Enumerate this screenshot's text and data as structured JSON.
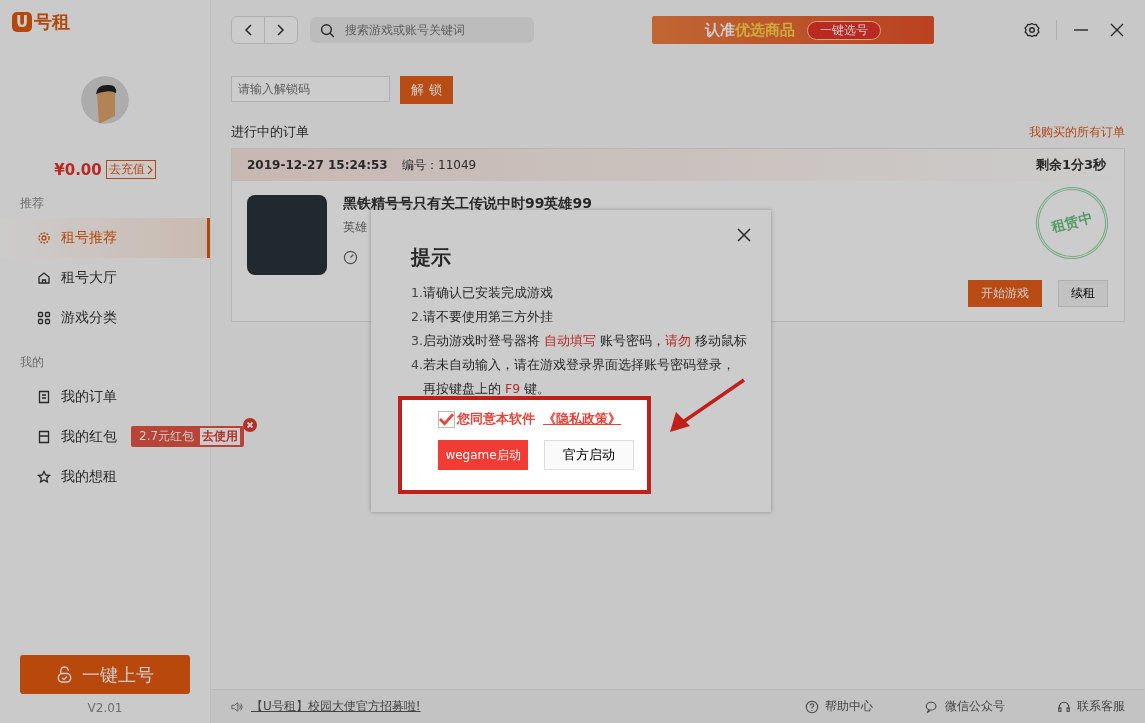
{
  "logo": {
    "mark": "U",
    "text": "号租"
  },
  "profile": {
    "balance": "¥0.00",
    "recharge": "去充值"
  },
  "sidebar": {
    "sections": [
      {
        "title": "推荐",
        "items": [
          {
            "label": "租号推荐",
            "selected": true
          },
          {
            "label": "租号大厅",
            "selected": false
          },
          {
            "label": "游戏分类",
            "selected": false
          }
        ]
      },
      {
        "title": "我的",
        "items": [
          {
            "label": "我的订单",
            "selected": false
          },
          {
            "label": "我的红包",
            "selected": false
          },
          {
            "label": "我的想租",
            "selected": false
          }
        ]
      }
    ]
  },
  "coupon_tip": {
    "amount": "2.7元红包",
    "action": "去使用"
  },
  "quick_login_button": "一键上号",
  "version": "V2.01",
  "toolbar": {
    "search_placeholder": "搜索游戏或账号关键词",
    "banner": {
      "text": "认准",
      "highlight": "优选商品",
      "button": "一键选号"
    }
  },
  "unlock": {
    "placeholder": "请输入解锁码",
    "button": "解 锁"
  },
  "orders": {
    "title": "进行中的订单",
    "all_link": "我购买的所有订单"
  },
  "order": {
    "time": "2019-12-27 15:24:53",
    "number": "编号：11049",
    "remaining": "剩余1分3秒",
    "title": "黑铁精号号只有关工传说中时99英雄99",
    "subtitle": "英雄",
    "stamp": "租赁中",
    "buttons": [
      {
        "label": "开始游戏",
        "kind": "primary"
      },
      {
        "label": "续租",
        "kind": "secondary"
      }
    ]
  },
  "modal": {
    "title": "提示",
    "steps": [
      {
        "number": "1.",
        "lines": [
          [
            {
              "text": "请确认已安装完成游戏",
              "highlight": false
            }
          ]
        ]
      },
      {
        "number": "2.",
        "lines": [
          [
            {
              "text": "请不要使用第三方外挂",
              "highlight": false
            }
          ]
        ]
      },
      {
        "number": "3.",
        "lines": [
          [
            {
              "text": "启动游戏时登号器将 ",
              "highlight": false
            },
            {
              "text": "自动填写",
              "highlight": true
            },
            {
              "text": " 账号密码，",
              "highlight": false
            },
            {
              "text": "请勿",
              "highlight": true
            },
            {
              "text": " 移动鼠标",
              "highlight": false
            }
          ]
        ]
      },
      {
        "number": "4.",
        "lines": [
          [
            {
              "text": "若未自动输入，请在游戏登录界面选择账号密码登录，",
              "highlight": false
            }
          ],
          [
            {
              "text": "再按键盘上的 ",
              "highlight": false
            },
            {
              "text": "F9",
              "highlight": true
            },
            {
              "text": " 键。",
              "highlight": false
            }
          ]
        ]
      }
    ],
    "agree": {
      "checked": true,
      "text": "您同意本软件",
      "link": "《隐私政策》"
    },
    "buttons": [
      {
        "label": "wegame启动",
        "kind": "primary"
      },
      {
        "label": "官方启动",
        "kind": "secondary"
      }
    ]
  },
  "footer": {
    "notice": "【U号租】校园大使官方招募啦!",
    "links": [
      {
        "label": "帮助中心"
      },
      {
        "label": "微信公众号"
      },
      {
        "label": "联系客服"
      }
    ]
  }
}
